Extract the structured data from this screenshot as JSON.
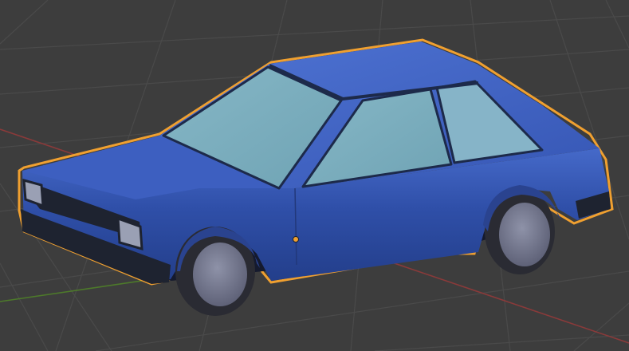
{
  "viewport": {
    "background_color": "#3d3d3d",
    "grid_line_color": "#4a4a4a",
    "x_axis_color": "#8a3a3a",
    "y_axis_color": "#4d7a2a"
  },
  "selected_object": {
    "kind": "car-model",
    "body_color": "#2f4fa8",
    "window_color": "#7fb0c0",
    "selection_outline_color": "#f0a030",
    "origin_marker_color": "#f0a030"
  }
}
